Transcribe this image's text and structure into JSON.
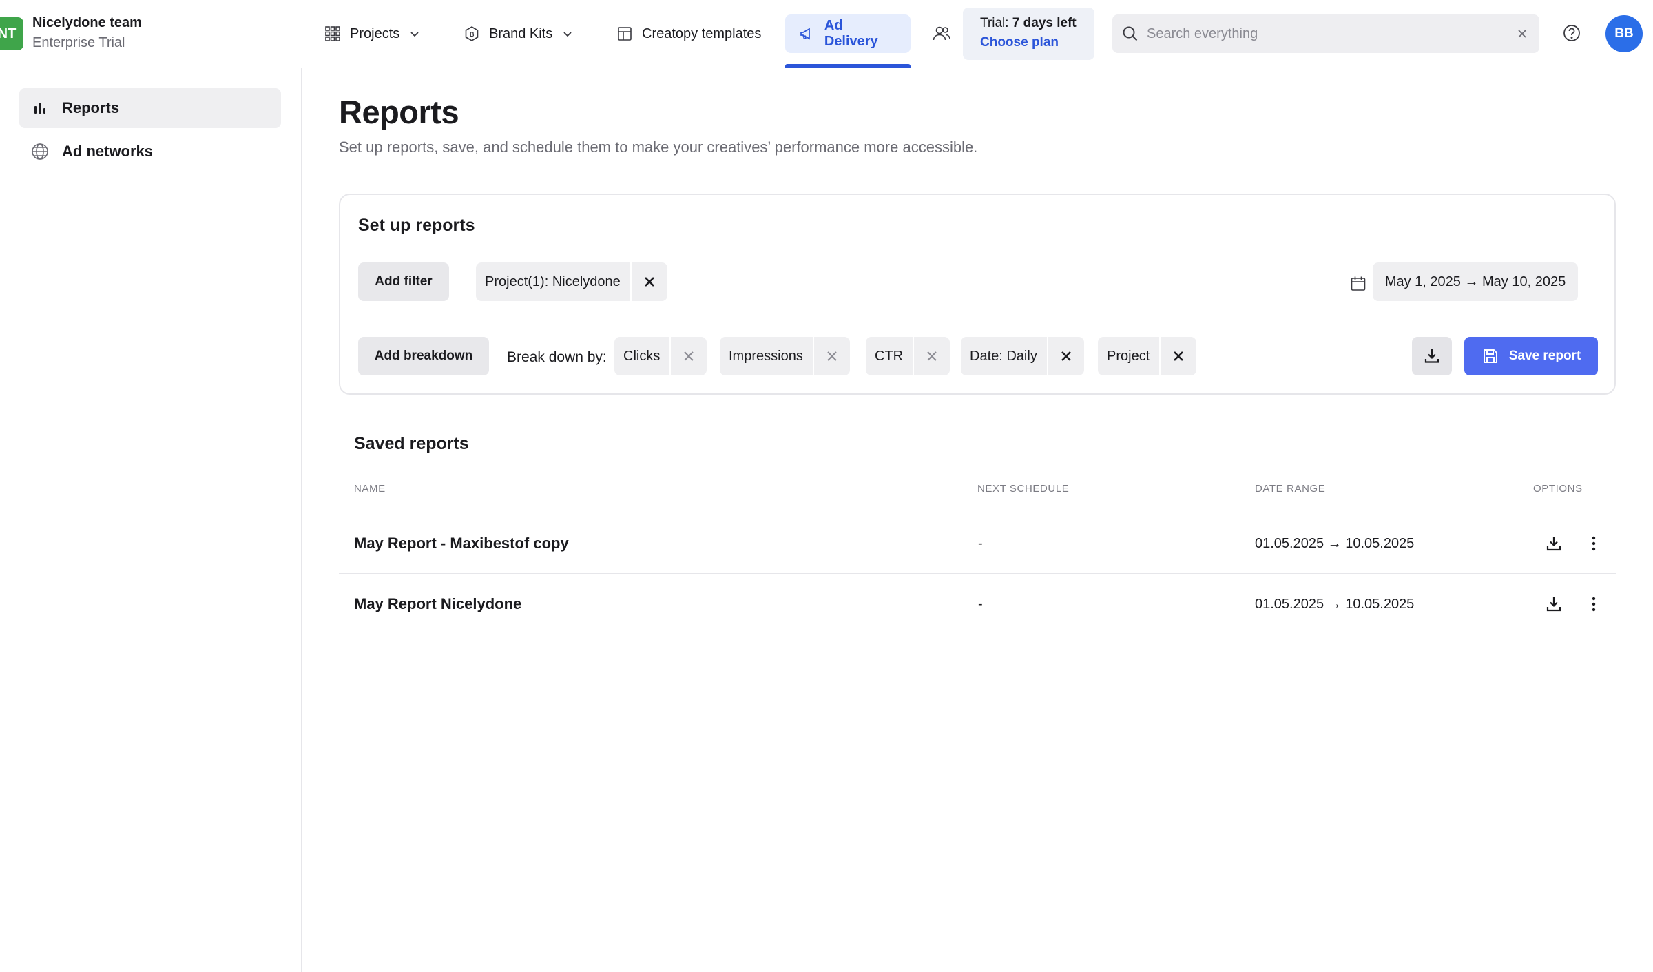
{
  "team": {
    "avatar_initials": "NT",
    "name": "Nicelydone team",
    "plan": "Enterprise Trial"
  },
  "nav": {
    "projects": "Projects",
    "brand_kits": "Brand Kits",
    "templates": "Creatopy templates",
    "ad_delivery": "Ad Delivery"
  },
  "trial": {
    "prefix": "Trial: ",
    "days_left": "7 days left",
    "choose_plan": "Choose plan"
  },
  "search": {
    "placeholder": "Search everything",
    "value": ""
  },
  "user": {
    "initials": "BB"
  },
  "sidebar": {
    "items": [
      {
        "label": "Reports",
        "icon": "bar-chart-icon",
        "active": true
      },
      {
        "label": "Ad networks",
        "icon": "globe-icon",
        "active": false
      }
    ]
  },
  "page": {
    "title": "Reports",
    "subtitle": "Set up reports, save, and schedule them to make your creatives’ performance more accessible."
  },
  "setup": {
    "title": "Set up reports",
    "add_filter": "Add filter",
    "filter_chip": {
      "key": "Project(1): ",
      "value": "Nicelydone"
    },
    "date_range": "May 1, 2025 → May 10, 2025",
    "add_breakdown": "Add breakdown",
    "breakdown_label": "Break down by:",
    "breakdowns": [
      "Clicks",
      "Impressions",
      "CTR",
      "Date: Daily",
      "Project"
    ],
    "save_report": "Save report"
  },
  "saved": {
    "title": "Saved reports",
    "columns": [
      "NAME",
      "NEXT SCHEDULE",
      "DATE RANGE",
      "OPTIONS"
    ],
    "rows": [
      {
        "name": "May Report - Maxibestof copy",
        "next_schedule": "-",
        "date_range": "01.05.2025 → 10.05.2025"
      },
      {
        "name": "May Report Nicelydone",
        "next_schedule": "-",
        "date_range": "01.05.2025 → 10.05.2025"
      }
    ]
  },
  "colors": {
    "accent": "#2b55d9",
    "primary_button": "#4f6bf0",
    "team_avatar": "#3fa54a",
    "user_avatar": "#2b6ee8"
  }
}
